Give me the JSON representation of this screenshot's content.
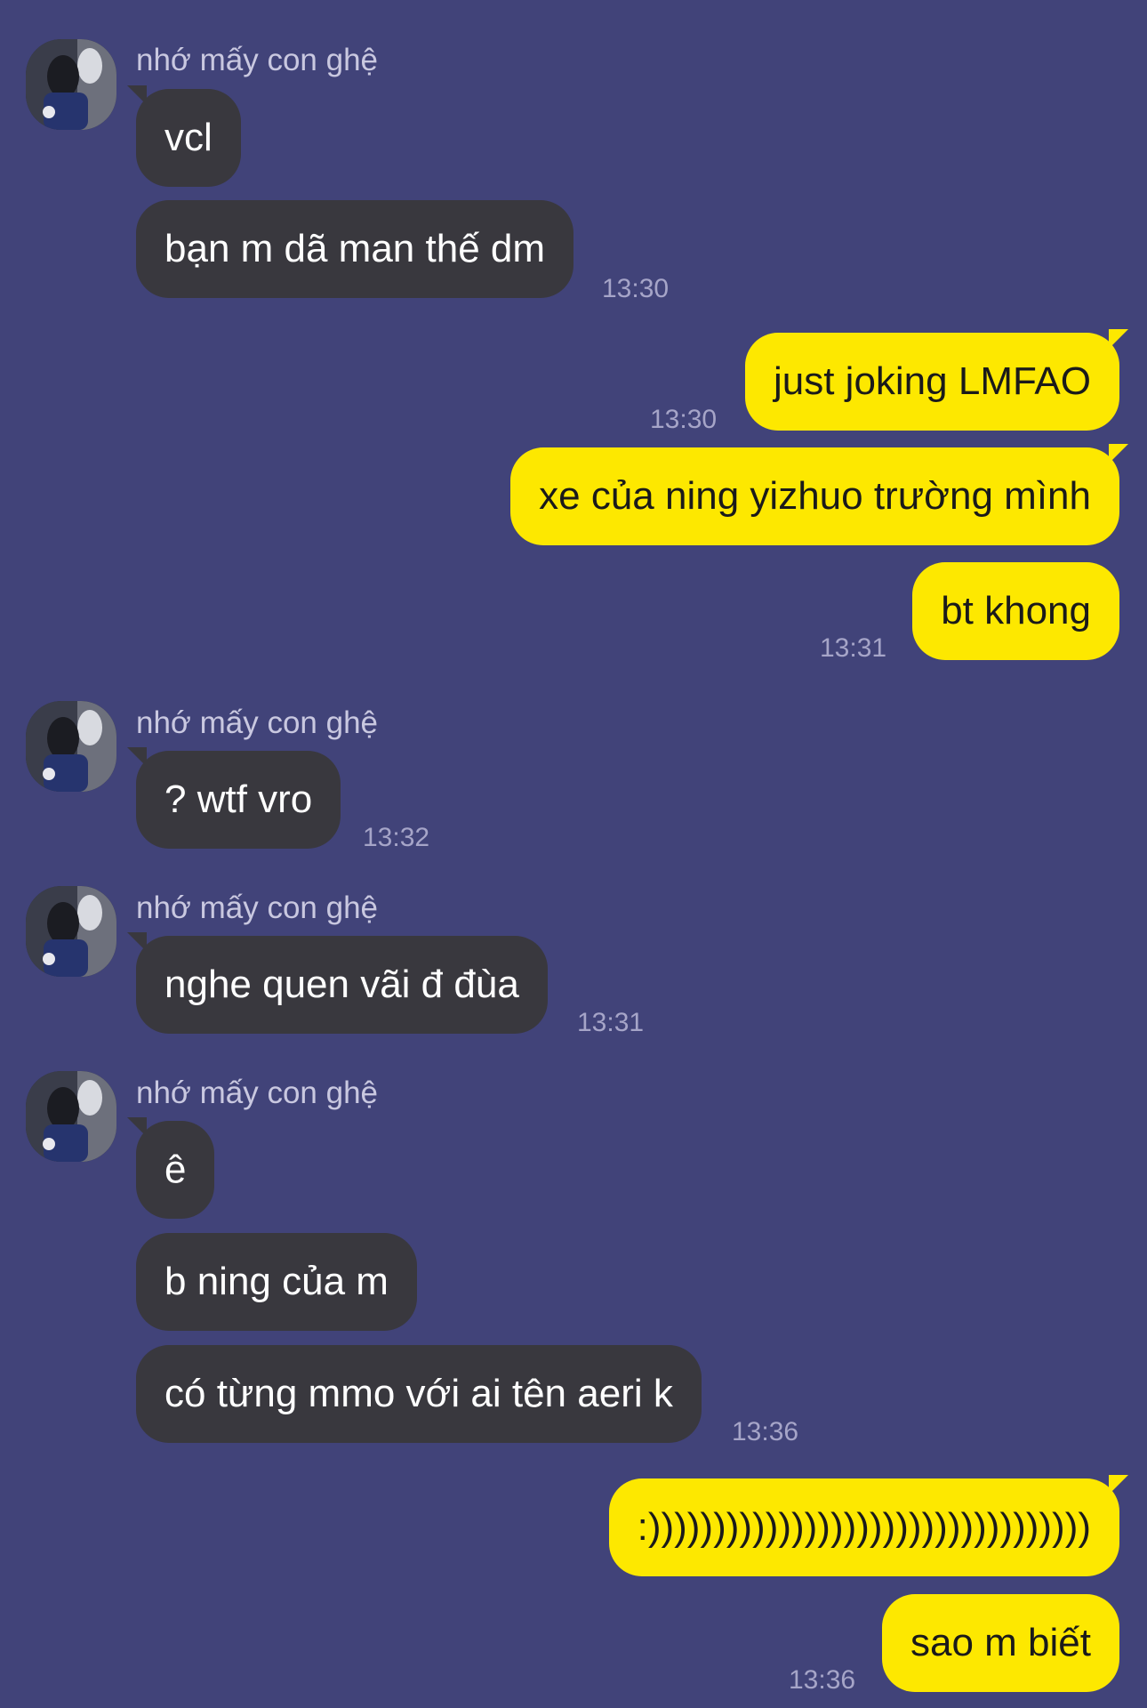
{
  "chat": {
    "sender_name": "nhớ mấy con ghệ",
    "avatar": "contact-avatar-photo",
    "colors": {
      "background": "#414379",
      "incoming_bubble": "#39383e",
      "outgoing_bubble": "#fde800",
      "timestamp": "#a6a5c8"
    },
    "messages": [
      {
        "from": "them",
        "text": "vcl"
      },
      {
        "from": "them",
        "text": "bạn m dã man thế dm",
        "time": "13:30"
      },
      {
        "from": "me",
        "text": "just joking LMFAO",
        "time": "13:30"
      },
      {
        "from": "me",
        "text": "xe của ning yizhuo trường mình"
      },
      {
        "from": "me",
        "text": "bt khong",
        "time": "13:31"
      },
      {
        "from": "them",
        "text": "? wtf vro",
        "time": "13:32"
      },
      {
        "from": "them",
        "text": "nghe quen vãi đ đùa",
        "time": "13:31"
      },
      {
        "from": "them",
        "text": "ê"
      },
      {
        "from": "them",
        "text": "b ning của m"
      },
      {
        "from": "them",
        "text": "có từng mmo với ai tên aeri k",
        "time": "13:36"
      },
      {
        "from": "me",
        "text": ":))))))))))))))))))))))))))))))))))"
      },
      {
        "from": "me",
        "text": "sao m biết",
        "time": "13:36"
      }
    ]
  }
}
